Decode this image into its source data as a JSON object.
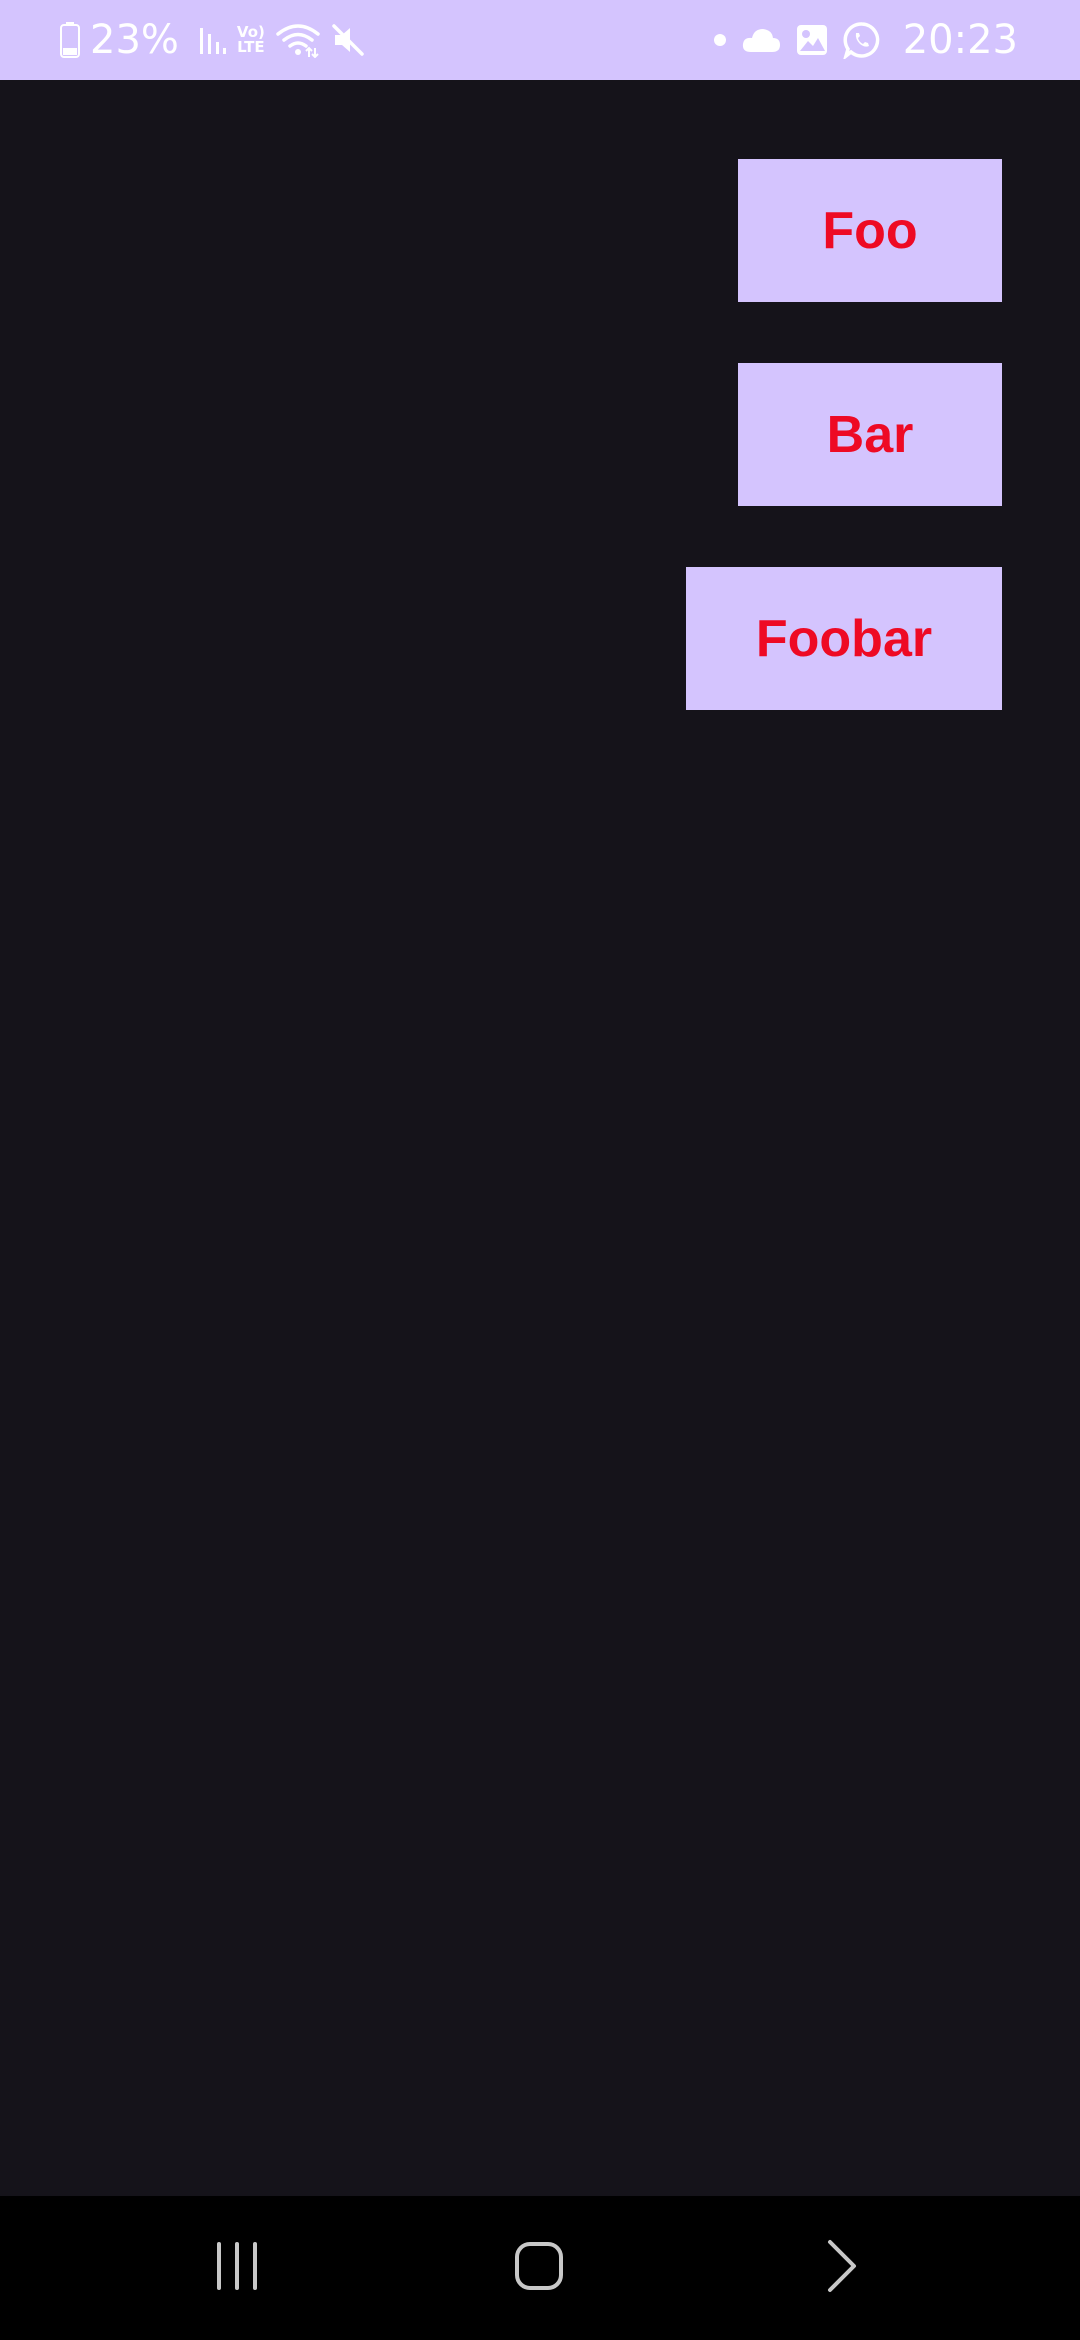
{
  "status_bar": {
    "battery_percent": "23%",
    "time": "20:23",
    "icons_left": [
      "battery-icon",
      "signal-icon",
      "volte-icon",
      "wifi-icon",
      "mute-icon"
    ],
    "icons_right": [
      "notification-dot-icon",
      "cloud-icon",
      "gallery-icon",
      "whatsapp-icon"
    ],
    "volte_top": "Vo)",
    "volte_bottom": "LTE"
  },
  "buttons": {
    "foo_label": "Foo",
    "bar_label": "Bar",
    "foobar_label": "Foobar"
  },
  "nav_bar": {
    "icons": [
      "recents-icon",
      "home-icon",
      "back-icon"
    ]
  },
  "colors": {
    "status_bar_bg": "#d4c4fe",
    "screen_bg": "#15131a",
    "button_bg": "#d4c4fe",
    "button_text": "#ee0a24",
    "nav_bar_bg": "#000000"
  }
}
